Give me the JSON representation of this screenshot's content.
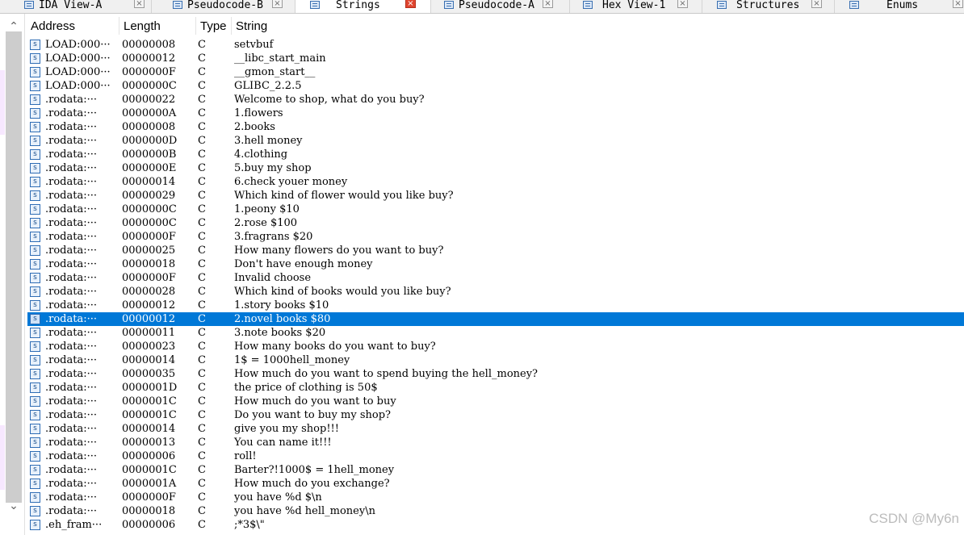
{
  "tabs": [
    {
      "label": "IDA View-A",
      "active": false
    },
    {
      "label": "Pseudocode-B",
      "active": false
    },
    {
      "label": "Strings",
      "active": true
    },
    {
      "label": "Pseudocode-A",
      "active": false
    },
    {
      "label": "Hex View-1",
      "active": false
    },
    {
      "label": "Structures",
      "active": false
    },
    {
      "label": "Enums",
      "active": false
    }
  ],
  "columns": {
    "address": "Address",
    "length": "Length",
    "type": "Type",
    "string": "String"
  },
  "rows": [
    {
      "address": "LOAD:000···",
      "length": "00000008",
      "type": "C",
      "string": "setvbuf"
    },
    {
      "address": "LOAD:000···",
      "length": "00000012",
      "type": "C",
      "string": "__libc_start_main"
    },
    {
      "address": "LOAD:000···",
      "length": "0000000F",
      "type": "C",
      "string": "__gmon_start__"
    },
    {
      "address": "LOAD:000···",
      "length": "0000000C",
      "type": "C",
      "string": "GLIBC_2.2.5"
    },
    {
      "address": ".rodata:···",
      "length": "00000022",
      "type": "C",
      "string": "Welcome to shop, what do you buy?"
    },
    {
      "address": ".rodata:···",
      "length": "0000000A",
      "type": "C",
      "string": "1.flowers"
    },
    {
      "address": ".rodata:···",
      "length": "00000008",
      "type": "C",
      "string": "2.books"
    },
    {
      "address": ".rodata:···",
      "length": "0000000D",
      "type": "C",
      "string": "3.hell money"
    },
    {
      "address": ".rodata:···",
      "length": "0000000B",
      "type": "C",
      "string": "4.clothing"
    },
    {
      "address": ".rodata:···",
      "length": "0000000E",
      "type": "C",
      "string": "5.buy my shop"
    },
    {
      "address": ".rodata:···",
      "length": "00000014",
      "type": "C",
      "string": "6.check youer money"
    },
    {
      "address": ".rodata:···",
      "length": "00000029",
      "type": "C",
      "string": "Which kind of flower would you like buy?"
    },
    {
      "address": ".rodata:···",
      "length": "0000000C",
      "type": "C",
      "string": "1.peony $10"
    },
    {
      "address": ".rodata:···",
      "length": "0000000C",
      "type": "C",
      "string": "2.rose $100"
    },
    {
      "address": ".rodata:···",
      "length": "0000000F",
      "type": "C",
      "string": "3.fragrans $20"
    },
    {
      "address": ".rodata:···",
      "length": "00000025",
      "type": "C",
      "string": "How many flowers do you want to buy?"
    },
    {
      "address": ".rodata:···",
      "length": "00000018",
      "type": "C",
      "string": "Don't have enough money"
    },
    {
      "address": ".rodata:···",
      "length": "0000000F",
      "type": "C",
      "string": "Invalid choose"
    },
    {
      "address": ".rodata:···",
      "length": "00000028",
      "type": "C",
      "string": "Which kind of books would you like buy?"
    },
    {
      "address": ".rodata:···",
      "length": "00000012",
      "type": "C",
      "string": "1.story books $10"
    },
    {
      "address": ".rodata:···",
      "length": "00000012",
      "type": "C",
      "string": "2.novel books $80",
      "selected": true
    },
    {
      "address": ".rodata:···",
      "length": "00000011",
      "type": "C",
      "string": "3.note books $20"
    },
    {
      "address": ".rodata:···",
      "length": "00000023",
      "type": "C",
      "string": "How many books do you want to buy?"
    },
    {
      "address": ".rodata:···",
      "length": "00000014",
      "type": "C",
      "string": "1$ = 1000hell_money"
    },
    {
      "address": ".rodata:···",
      "length": "00000035",
      "type": "C",
      "string": "How much do you want to spend buying the hell_money?"
    },
    {
      "address": ".rodata:···",
      "length": "0000001D",
      "type": "C",
      "string": "the price of clothing is 50$"
    },
    {
      "address": ".rodata:···",
      "length": "0000001C",
      "type": "C",
      "string": "How much do you want to buy"
    },
    {
      "address": ".rodata:···",
      "length": "0000001C",
      "type": "C",
      "string": "Do you want to buy my shop?"
    },
    {
      "address": ".rodata:···",
      "length": "00000014",
      "type": "C",
      "string": "give you my shop!!!"
    },
    {
      "address": ".rodata:···",
      "length": "00000013",
      "type": "C",
      "string": "You can name it!!!"
    },
    {
      "address": ".rodata:···",
      "length": "00000006",
      "type": "C",
      "string": "roll!"
    },
    {
      "address": ".rodata:···",
      "length": "0000001C",
      "type": "C",
      "string": "Barter?!1000$ = 1hell_money"
    },
    {
      "address": ".rodata:···",
      "length": "0000001A",
      "type": "C",
      "string": "How much do you exchange?"
    },
    {
      "address": ".rodata:···",
      "length": "0000000F",
      "type": "C",
      "string": "you have %d $\\n"
    },
    {
      "address": ".rodata:···",
      "length": "00000018",
      "type": "C",
      "string": "you have %d hell_money\\n"
    },
    {
      "address": ".eh_fram···",
      "length": "00000006",
      "type": "C",
      "string": ";*3$\\\""
    }
  ],
  "watermark": "CSDN @My6n",
  "colors": {
    "selection": "#0078d7",
    "close_active": "#e0452f"
  },
  "icons": {
    "string_row": "string-item-icon",
    "tab": "tab-view-icon"
  }
}
